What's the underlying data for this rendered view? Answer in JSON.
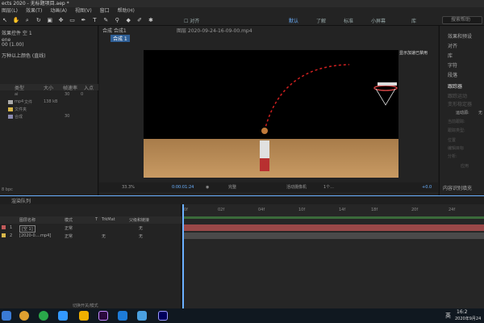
{
  "titlebar": {
    "title": "ects 2020 - 无标题项目.aep *"
  },
  "menubar": {
    "items": [
      "图层(L)",
      "效果(T)",
      "动画(A)",
      "视图(V)",
      "窗口",
      "帮助(H)"
    ]
  },
  "toolbar": {
    "snap_label": "对齐",
    "workspaces": [
      "默认",
      "了解",
      "标准",
      "小屏幕",
      "库"
    ],
    "search_placeholder": "搜索帮助"
  },
  "left_panel": {
    "effects_title": "效果控件 空 1",
    "line2": "ene",
    "line3": "00 (1.00)",
    "line4": "万种以上颜色 (直线)",
    "columns": [
      "类型",
      "大小",
      "帧速率",
      "入点"
    ],
    "rows": [
      {
        "name": "ai",
        "type": "",
        "size": "30",
        "fps": "0"
      },
      {
        "name": "mp4",
        "type": "文件",
        "size": "138 kB",
        "fps": ""
      },
      {
        "name": "",
        "type": "文件夹",
        "size": "",
        "fps": ""
      },
      {
        "name": "",
        "type": "合成",
        "size": "",
        "fps": "30"
      }
    ],
    "bpc": "8 bpc"
  },
  "viewer": {
    "tab_comp": "合成 合成1",
    "tab_layer": "图层 2020-09-24-16-09-00.mp4",
    "subtab": "合成 1",
    "overlay_text": "显示加速已禁用",
    "zoom": "33.3%",
    "timecode": "0:00:01:24",
    "quality": "完整",
    "camera": "活动摄像机",
    "views": "1个...",
    "exposure": "+0.0"
  },
  "right_panel": {
    "items": [
      "效果和预设",
      "对齐",
      "库",
      "字符",
      "段落",
      "跟踪器"
    ],
    "dim_items": [
      "跟踪运动",
      "变形稳定器",
      "跟踪摄像机",
      "稳定运动"
    ],
    "motion_source_label": "运动源:",
    "motion_source_value": "无",
    "current_track_label": "当前跟踪:",
    "track_type_label": "跟踪类型:",
    "position_label": "位置",
    "rotation_label": "旋转",
    "scale_label": "缩放",
    "edit_target": "编辑目标",
    "options": "选项",
    "analyze": "分析:",
    "reset": "重置",
    "apply": "应用",
    "content_aware": "内容识别填充"
  },
  "timeline": {
    "tab_label": "渲染队列",
    "columns": [
      "图层名称",
      "模式",
      "T",
      "TrkMat",
      "父级和链接"
    ],
    "layers": [
      {
        "num": "1",
        "name": "[空 1]",
        "mode": "正常",
        "trkmat": "",
        "parent": "无"
      },
      {
        "num": "2",
        "name": "[2020-0....mp4]",
        "mode": "正常",
        "trkmat": "无",
        "parent": "无"
      }
    ],
    "ruler": [
      "0f",
      "02f",
      "04f",
      "10f",
      "14f",
      "18f",
      "20f",
      "24f"
    ],
    "footer": "切换开关/模式"
  },
  "taskbar": {
    "lang": "英",
    "time": "16:2",
    "date": "2020年9月24"
  },
  "colors": {
    "accent": "#6ab0ff",
    "layer_red": "#c25a5a"
  }
}
